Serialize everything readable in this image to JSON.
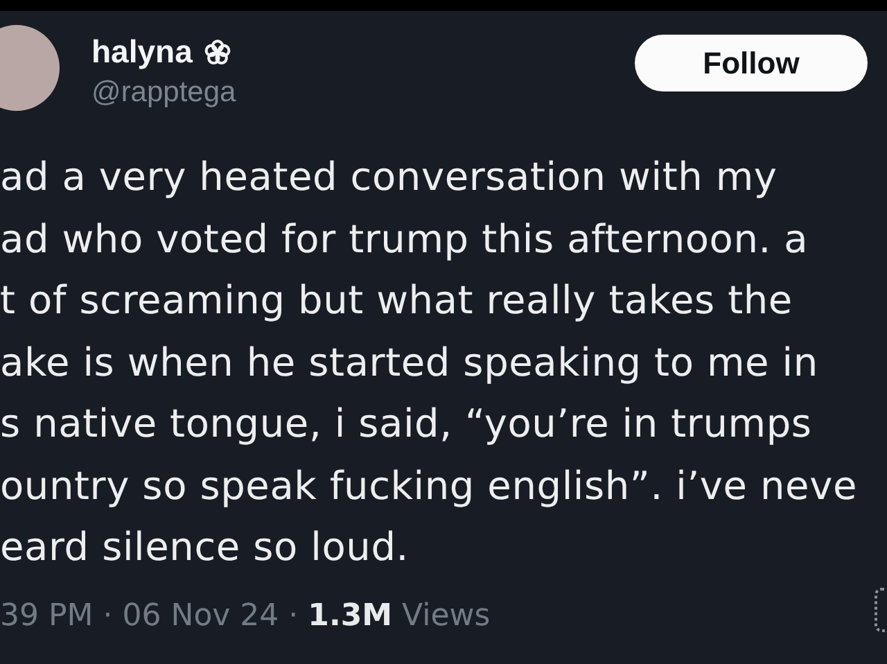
{
  "author": {
    "name": "halyna",
    "handle": "@rapptega"
  },
  "follow_button": {
    "label": "Follow"
  },
  "tweet_lines": [
    "ad a very heated conversation with my",
    "ad who voted for trump this afternoon. a",
    "t of screaming but what really takes the",
    "ake is when he started speaking to me in",
    "s native tongue, i said, “you’re in trumps",
    "ountry so speak fucking english”. i’ve neve",
    "eard silence so loud."
  ],
  "meta": {
    "time": "39 PM",
    "separator_1": "·",
    "date": "06 Nov 24",
    "separator_2": "·",
    "views_count": "1.3M",
    "views_label": "Views"
  }
}
